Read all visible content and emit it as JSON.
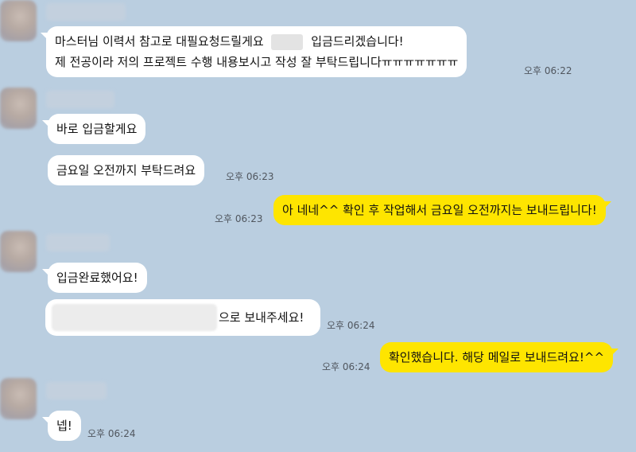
{
  "messages": [
    {
      "id": 1,
      "sender": "other",
      "lines": [
        "마스터님 이력서 참고로 대필요청드릴게요",
        "입금드리겠습니다!",
        "제 전공이라 저의 프로젝트 수행 내용보시고 작성 잘 부탁드립니다ㅠㅠㅠㅠㅠㅠㅠ"
      ],
      "time": "오후 06:22"
    },
    {
      "id": 2,
      "sender": "other",
      "text": "바로 입금할게요"
    },
    {
      "id": 3,
      "sender": "other",
      "text": "금요일 오전까지 부탁드려요",
      "time": "오후 06:23"
    },
    {
      "id": 4,
      "sender": "me",
      "text": "아 네네^^ 확인 후 작업해서 금요일 오전까지는 보내드립니다!",
      "time": "오후 06:23"
    },
    {
      "id": 5,
      "sender": "other",
      "text": "입금완료했어요!"
    },
    {
      "id": 6,
      "sender": "other",
      "text": "으로 보내주세요!",
      "time": "오후 06:24"
    },
    {
      "id": 7,
      "sender": "me",
      "text": "확인했습니다. 해당 메일로 보내드려요!^^",
      "time": "오후 06:24"
    },
    {
      "id": 8,
      "sender": "other",
      "text": "넵!",
      "time": "오후 06:24"
    }
  ],
  "colors": {
    "background": "#bacee0",
    "incoming": "#ffffff",
    "outgoing": "#fee500",
    "time": "#50565e"
  }
}
